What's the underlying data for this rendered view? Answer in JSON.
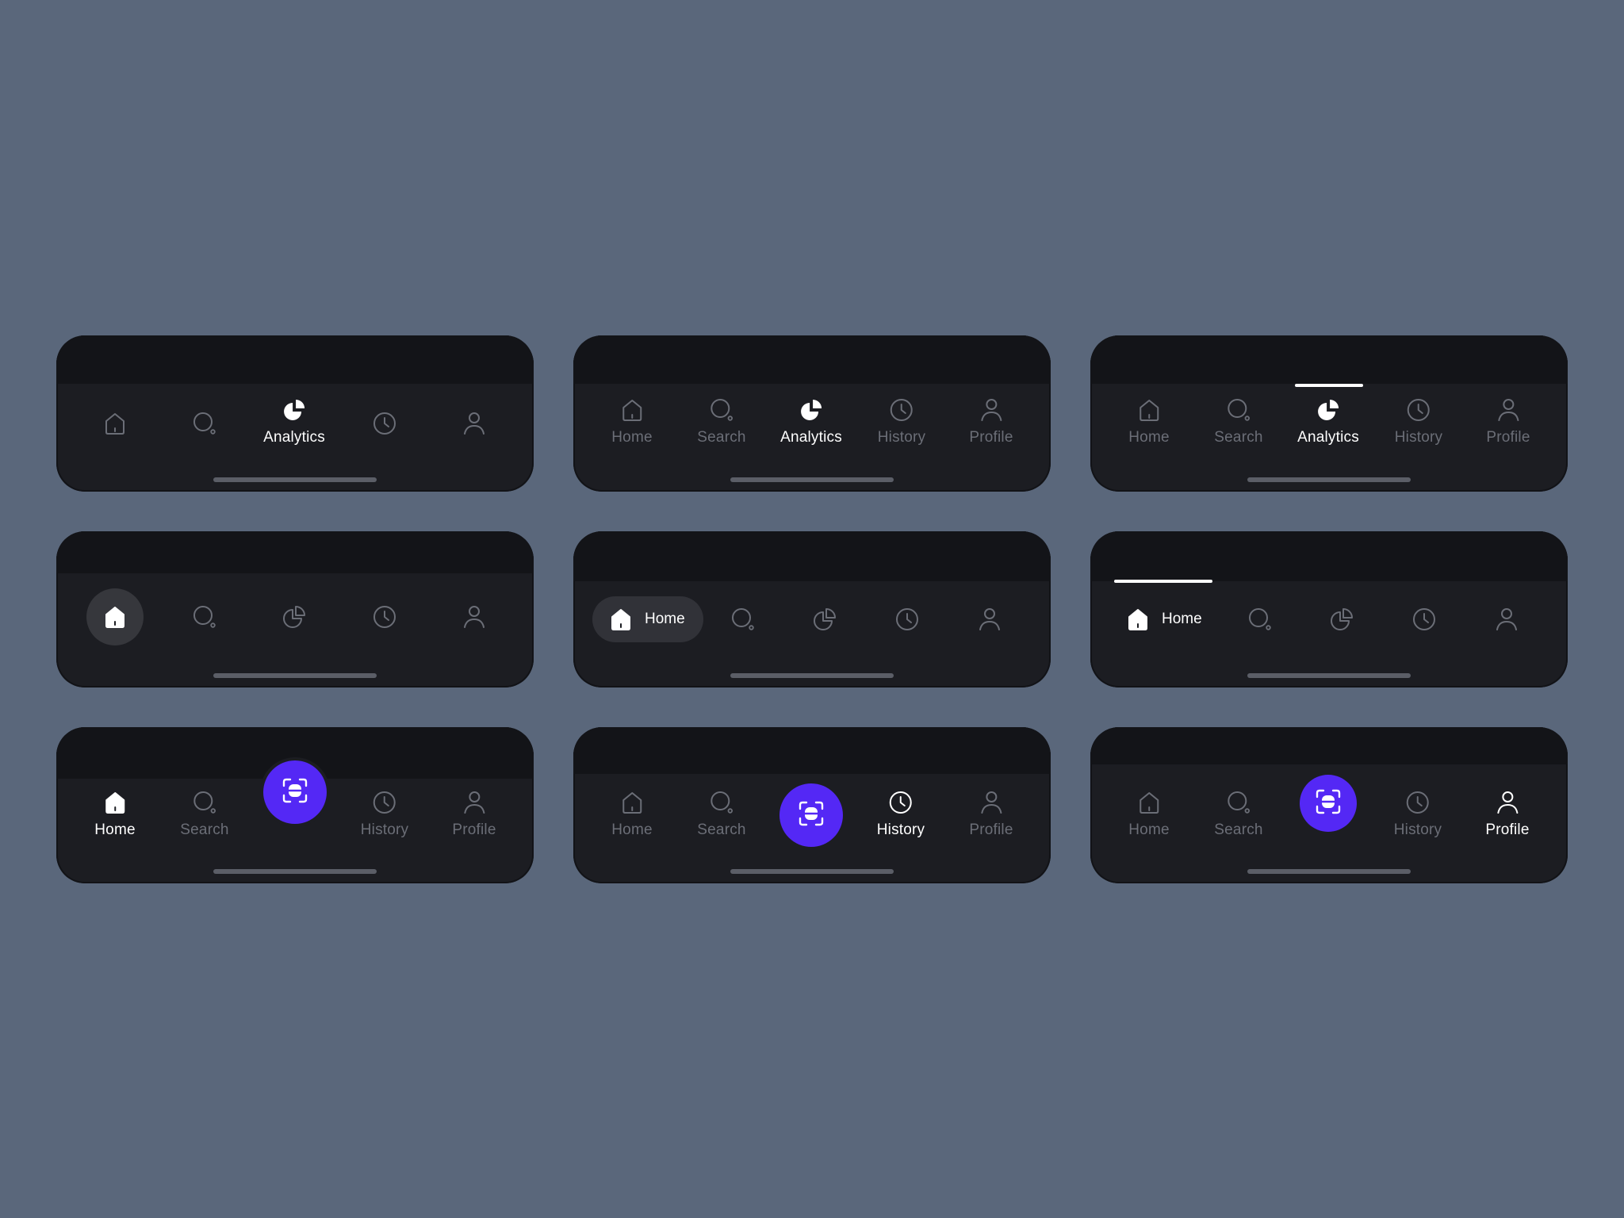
{
  "labels": {
    "home": "Home",
    "search": "Search",
    "analytics": "Analytics",
    "history": "History",
    "profile": "Profile"
  },
  "colors": {
    "background": "#5a677b",
    "bar": "#1c1d22",
    "bar_top": "#131418",
    "inactive": "#6b6e77",
    "active": "#ffffff",
    "accent": "#5428f5"
  },
  "icons": [
    "home-icon",
    "search-icon",
    "analytics-icon",
    "history-icon",
    "profile-icon",
    "scan-icon"
  ]
}
